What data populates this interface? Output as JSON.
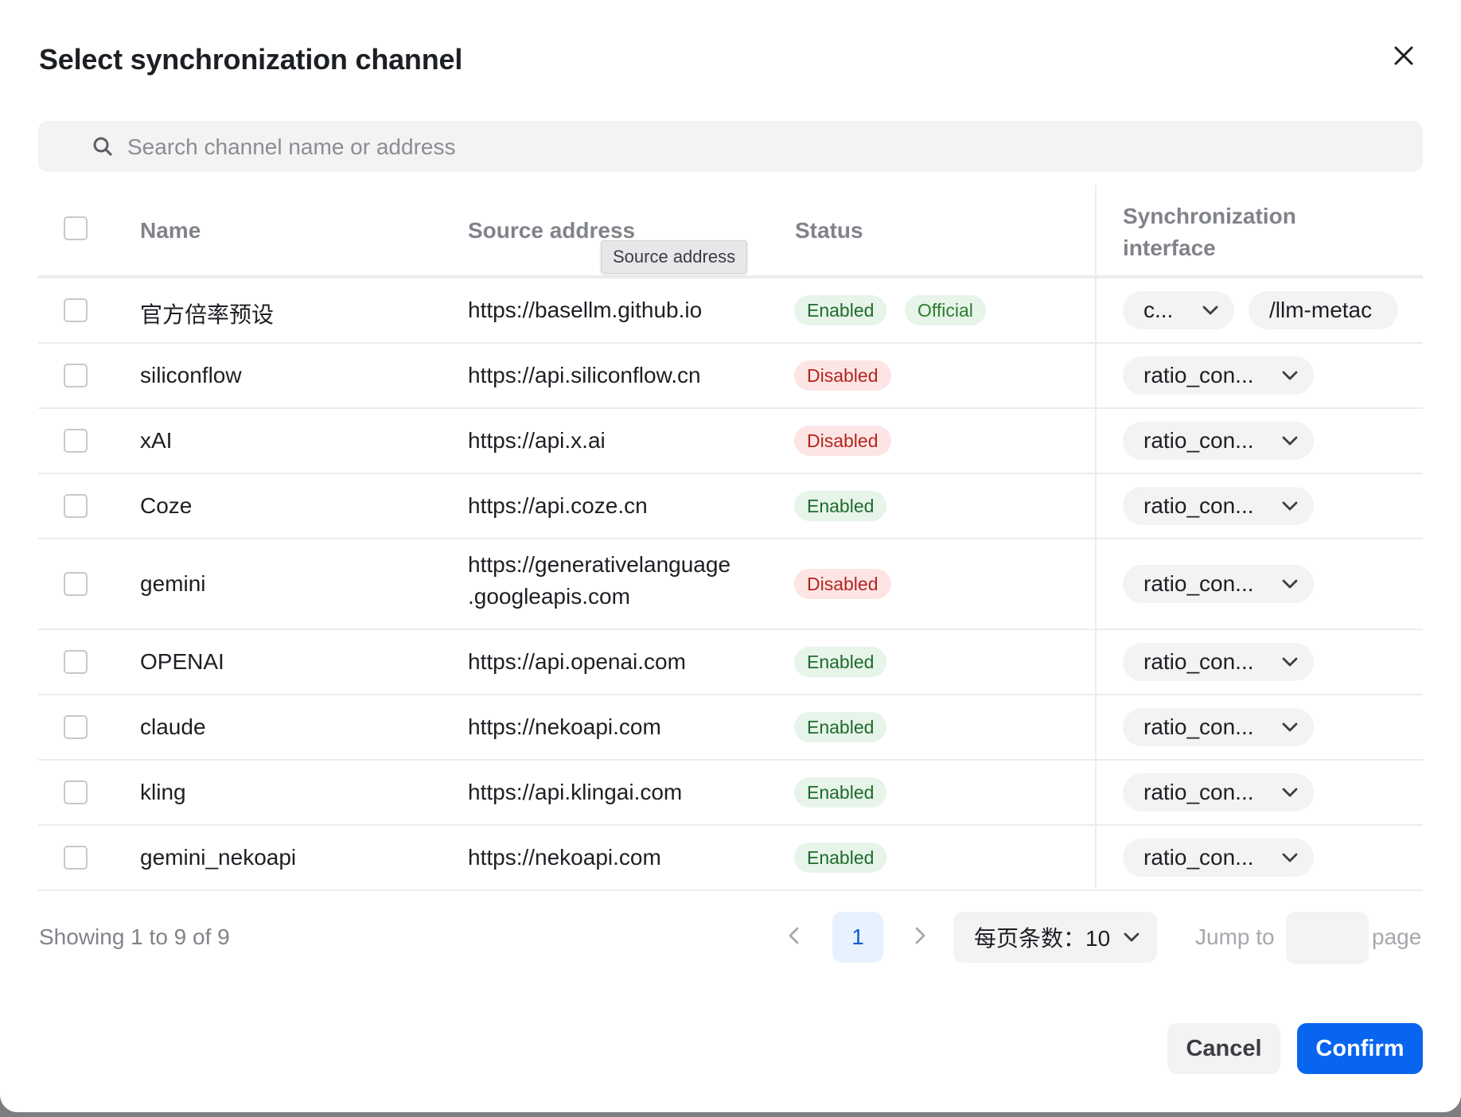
{
  "dialog": {
    "title": "Select synchronization channel"
  },
  "search": {
    "placeholder": "Search channel name or address"
  },
  "table": {
    "columns": {
      "name": "Name",
      "source_address": "Source address",
      "status": "Status",
      "sync_interface": "Synchronization interface"
    },
    "tooltip": "Source address",
    "rows": [
      {
        "name": "官方倍率预设",
        "address": "https://basellm.github.io",
        "status": "Enabled",
        "extra_tag": "Official",
        "interface": "c...",
        "path": "/llm-metac"
      },
      {
        "name": "siliconflow",
        "address": "https://api.siliconflow.cn",
        "status": "Disabled",
        "interface": "ratio_con..."
      },
      {
        "name": "xAI",
        "address": "https://api.x.ai",
        "status": "Disabled",
        "interface": "ratio_con..."
      },
      {
        "name": "Coze",
        "address": "https://api.coze.cn",
        "status": "Enabled",
        "interface": "ratio_con..."
      },
      {
        "name": "gemini",
        "address": "https://generativelanguage.googleapis.com",
        "address_line1": "https://generativelanguage",
        "address_line2": ".googleapis.com",
        "status": "Disabled",
        "interface": "ratio_con..."
      },
      {
        "name": "OPENAI",
        "address": "https://api.openai.com",
        "status": "Enabled",
        "interface": "ratio_con..."
      },
      {
        "name": "claude",
        "address": "https://nekoapi.com",
        "status": "Enabled",
        "interface": "ratio_con..."
      },
      {
        "name": "kling",
        "address": "https://api.klingai.com",
        "status": "Enabled",
        "interface": "ratio_con..."
      },
      {
        "name": "gemini_nekoapi",
        "address": "https://nekoapi.com",
        "status": "Enabled",
        "interface": "ratio_con..."
      }
    ]
  },
  "pagination": {
    "summary": "Showing 1 to 9 of 9",
    "current_page": "1",
    "page_size_label": "每页条数：10",
    "jump_to": "Jump to",
    "page": "page",
    "jump_value": ""
  },
  "actions": {
    "cancel": "Cancel",
    "confirm": "Confirm"
  },
  "colors": {
    "primary": "#0865f0",
    "enabled_bg": "#e6f4e9",
    "enabled_text": "#1f6b2b",
    "disabled_bg": "#fde5e5",
    "disabled_text": "#b3261e"
  }
}
